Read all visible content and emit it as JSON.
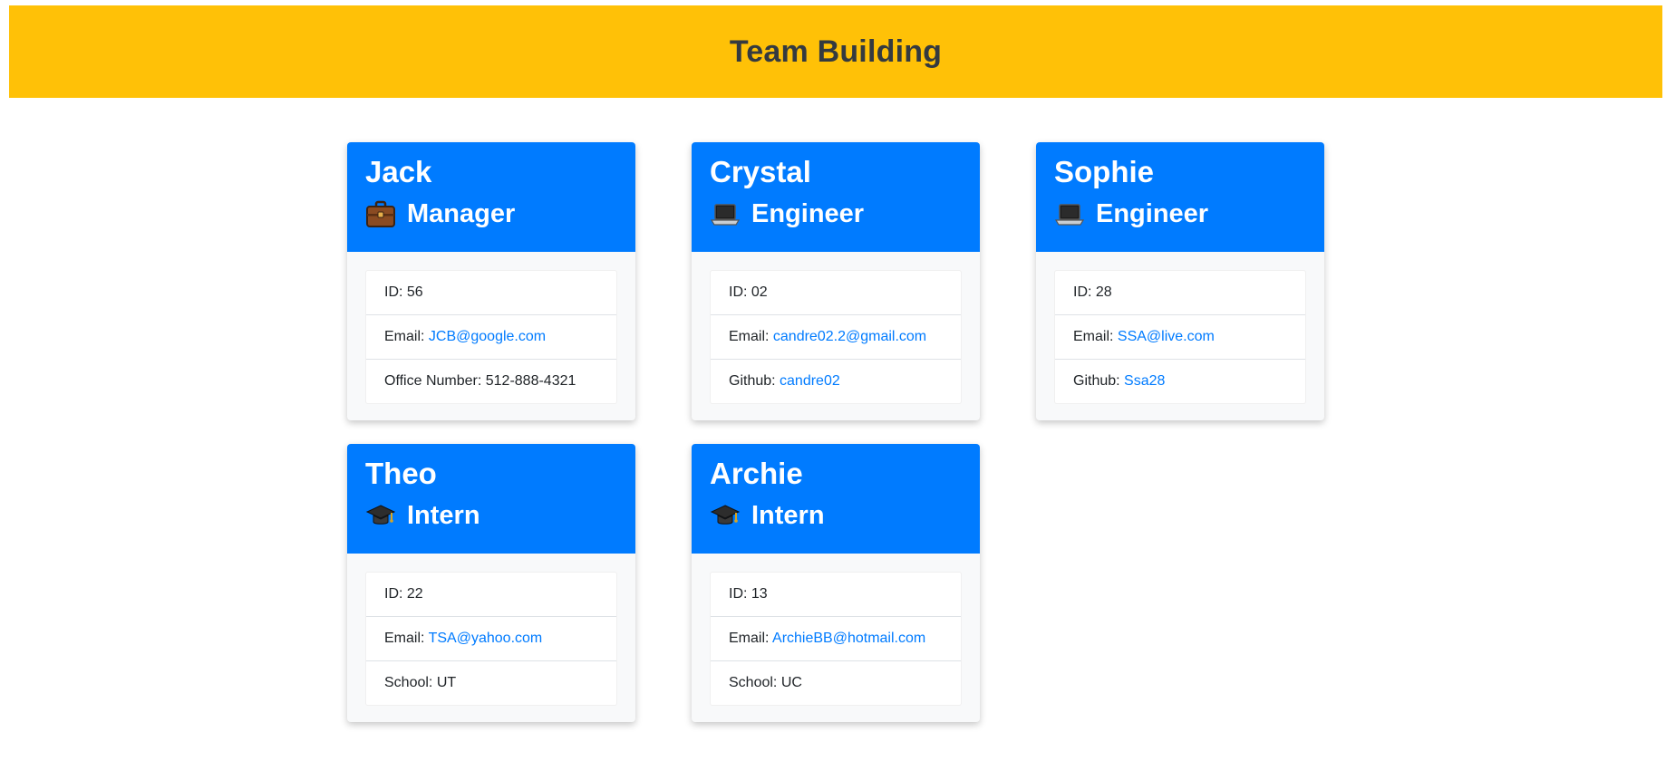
{
  "page": {
    "title": "Team Building",
    "header_color": "#ffc107",
    "card_header_color": "#007bff",
    "link_color": "#007bff"
  },
  "team": [
    {
      "name": "Jack",
      "role": "Manager",
      "role_icon": "briefcase-icon",
      "id_label": "ID: ",
      "id": "56",
      "email_label": "Email: ",
      "email": "JCB@google.com",
      "extra_label": "Office Number: ",
      "extra": "512-888-4321"
    },
    {
      "name": "Crystal",
      "role": "Engineer",
      "role_icon": "laptop-icon",
      "id_label": "ID: ",
      "id": "02",
      "email_label": "Email: ",
      "email": "candre02.2@gmail.com",
      "extra_label": "Github: ",
      "extra": "candre02"
    },
    {
      "name": "Sophie",
      "role": "Engineer",
      "role_icon": "laptop-icon",
      "id_label": "ID: ",
      "id": "28",
      "email_label": "Email: ",
      "email": "SSA@live.com",
      "extra_label": "Github: ",
      "extra": "Ssa28"
    },
    {
      "name": "Theo",
      "role": "Intern",
      "role_icon": "graduation-cap-icon",
      "id_label": "ID: ",
      "id": "22",
      "email_label": "Email: ",
      "email": "TSA@yahoo.com",
      "extra_label": "School: ",
      "extra": "UT"
    },
    {
      "name": "Archie",
      "role": "Intern",
      "role_icon": "graduation-cap-icon",
      "id_label": "ID: ",
      "id": "13",
      "email_label": "Email: ",
      "email": "ArchieBB@hotmail.com",
      "extra_label": "School: ",
      "extra": "UC"
    }
  ]
}
